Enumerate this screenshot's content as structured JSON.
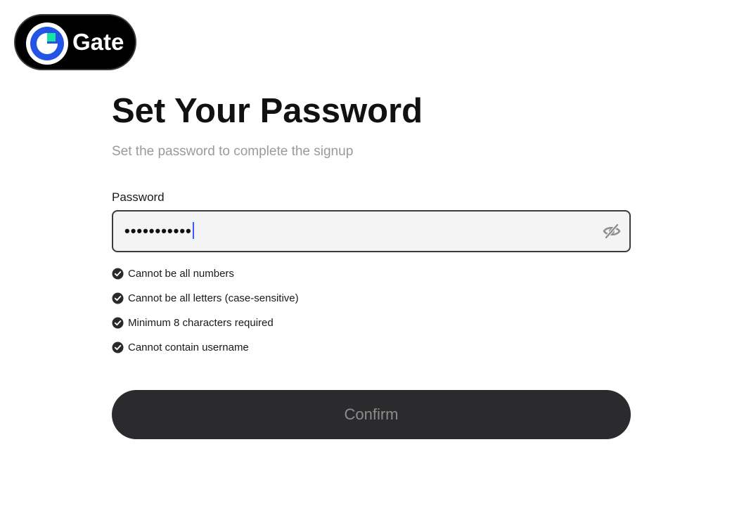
{
  "brand": {
    "name": "Gate",
    "logo_icon": "gate-logo-icon",
    "colors": {
      "pill_background": "#000000",
      "ring_blue": "#2354e6",
      "square_green": "#17e6a1"
    }
  },
  "form": {
    "title": "Set Your Password",
    "subtitle": "Set the password to complete the signup",
    "password": {
      "label": "Password",
      "masked_value": "•••••••••••",
      "toggle_icon": "eye-slash-icon"
    },
    "rules": [
      {
        "text": "Cannot be all numbers",
        "icon": "check-circle-icon",
        "satisfied": true
      },
      {
        "text": "Cannot be all letters (case-sensitive)",
        "icon": "check-circle-icon",
        "satisfied": true
      },
      {
        "text": "Minimum 8 characters required",
        "icon": "check-circle-icon",
        "satisfied": true
      },
      {
        "text": "Cannot contain username",
        "icon": "check-circle-icon",
        "satisfied": true
      }
    ],
    "confirm_label": "Confirm"
  },
  "colors": {
    "button_background": "#2b2b2d",
    "button_text": "#8c8c8c",
    "subtitle_text": "#9a9a9a",
    "caret": "#3d5afe"
  }
}
